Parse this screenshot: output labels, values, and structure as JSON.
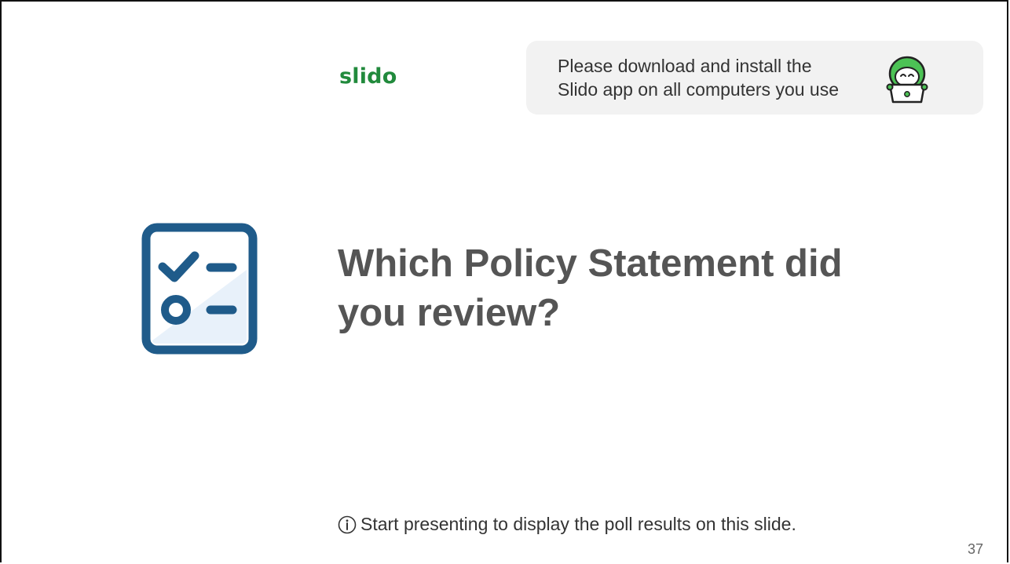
{
  "slide": {
    "logo_text": "slido",
    "banner": {
      "line1": "Please download and install the",
      "line2": "Slido app on all computers you use"
    },
    "question": {
      "line1": "Which Policy Statement did",
      "line2": "you review?"
    },
    "hint": "Start presenting to display the poll results on this slide.",
    "page_number": "37"
  },
  "icons": {
    "poll": "poll-checklist-icon",
    "mascot": "slido-mascot-laptop-icon",
    "info": "info-circle-icon"
  },
  "colors": {
    "brand_green": "#218a3c",
    "icon_blue": "#1f5b8a",
    "icon_fill": "#e8f1fa",
    "question_text": "#555555",
    "banner_bg": "#f2f2f2"
  }
}
